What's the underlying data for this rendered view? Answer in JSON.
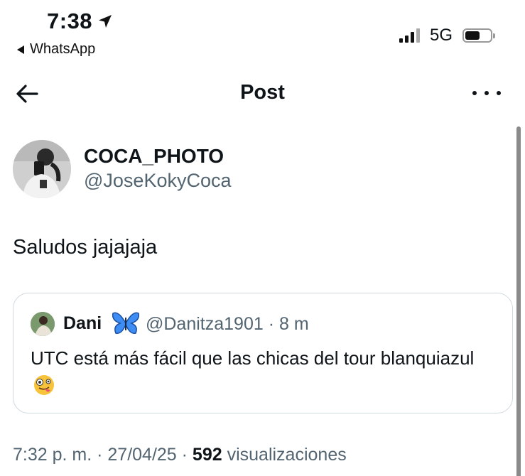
{
  "status_bar": {
    "time": "7:38",
    "back_app": "WhatsApp",
    "network": "5G",
    "battery_level": 0.6
  },
  "header": {
    "title": "Post"
  },
  "post": {
    "author_name": "COCA_PHOTO",
    "author_handle": "@JoseKokyCoca",
    "text": "Saludos jajajaja"
  },
  "quoted": {
    "name": "Dani",
    "handle_time": "@Danitza1901 · 8 m",
    "text": "UTC está más fácil que las chicas del tour blanquiazul"
  },
  "meta": {
    "time_date": "7:32 p. m. · 27/04/25 · ",
    "views_count": "592",
    "views_label": " visualizaciones"
  },
  "icons": {
    "location": "location-arrow-icon",
    "back": "back-arrow-icon",
    "more": "more-options-icon",
    "butterfly": "butterfly-emoji",
    "tongue": "zany-face-emoji"
  },
  "colors": {
    "text": "#0f1419",
    "secondary": "#536471",
    "border": "#cfd9de",
    "butterfly": "#3d8df5"
  }
}
